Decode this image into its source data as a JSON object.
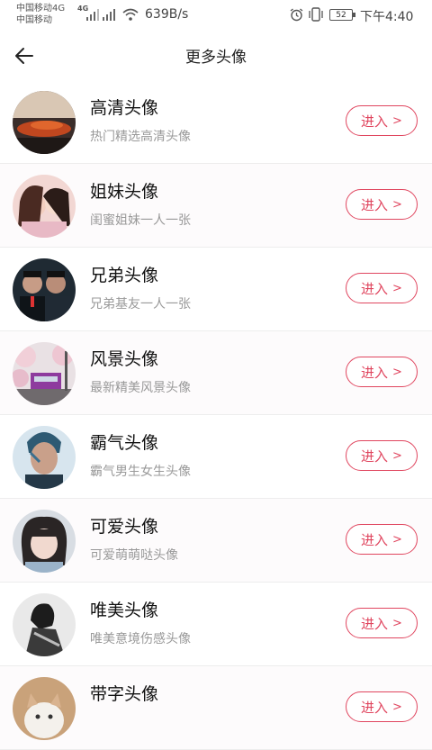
{
  "status_bar": {
    "carrier1": "中国移动4G",
    "carrier2": "中国移动",
    "net_tag": "4G",
    "speed": "639B/s",
    "battery": "52",
    "time": "下午4:40"
  },
  "header": {
    "title": "更多头像"
  },
  "items": [
    {
      "name": "高清头像",
      "desc": "热门精选高清头像",
      "button": "进入",
      "chevron": ">"
    },
    {
      "name": "姐妹头像",
      "desc": "闺蜜姐妹一人一张",
      "button": "进入",
      "chevron": ">"
    },
    {
      "name": "兄弟头像",
      "desc": "兄弟基友一人一张",
      "button": "进入",
      "chevron": ">"
    },
    {
      "name": "风景头像",
      "desc": "最新精美风景头像",
      "button": "进入",
      "chevron": ">"
    },
    {
      "name": "霸气头像",
      "desc": "霸气男生女生头像",
      "button": "进入",
      "chevron": ">"
    },
    {
      "name": "可爱头像",
      "desc": "可爱萌萌哒头像",
      "button": "进入",
      "chevron": ">"
    },
    {
      "name": "唯美头像",
      "desc": "唯美意境伤感头像",
      "button": "进入",
      "chevron": ">"
    },
    {
      "name": "带字头像",
      "desc": "",
      "button": "进入",
      "chevron": ">"
    }
  ],
  "colors": {
    "accent": "#e0465f"
  }
}
